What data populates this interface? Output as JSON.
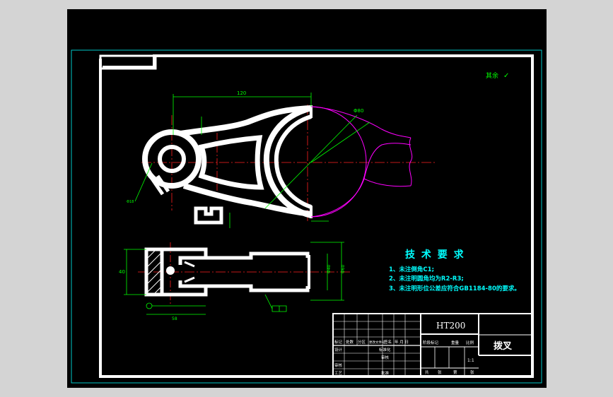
{
  "drawing": {
    "roughness_note": "其余",
    "roughness_symbol": "✓",
    "tech_requirements": {
      "title": "技 术 要 求",
      "items": [
        "1、未注倒角C1;",
        "2、未注明圆角均为R2-R3;",
        "3、未注明形位公差应符合GB1184-80的要求。"
      ]
    },
    "dimensions": {
      "top_length": "120",
      "top_dia": "Φ80",
      "left_height": "40",
      "bottom_width": "58",
      "right_dia_1": "Φ40",
      "right_dia_2": "Φ60"
    },
    "title_block": {
      "material": "HT200",
      "part_name": "拨叉",
      "scale": "1:1",
      "row_labels": [
        "标记",
        "处数",
        "分区",
        "更改文件号",
        "签名",
        "年 月 日"
      ],
      "left_labels": [
        "设计",
        "审核",
        "工艺"
      ],
      "mid_labels": [
        "标准化",
        "审核",
        "批准"
      ],
      "stage_labels": [
        "阶段标记",
        "重量",
        "比例"
      ],
      "bottom_labels": [
        "共",
        "张",
        "第",
        "张"
      ]
    }
  },
  "colors": {
    "background": "#000000",
    "outline": "#ffffff",
    "frame_cyan": "#00c8c8",
    "dimension_green": "#00ff00",
    "center_red": "#ff2020",
    "phantom_magenta": "#ff00ff",
    "text_cyan": "#00ffff"
  }
}
